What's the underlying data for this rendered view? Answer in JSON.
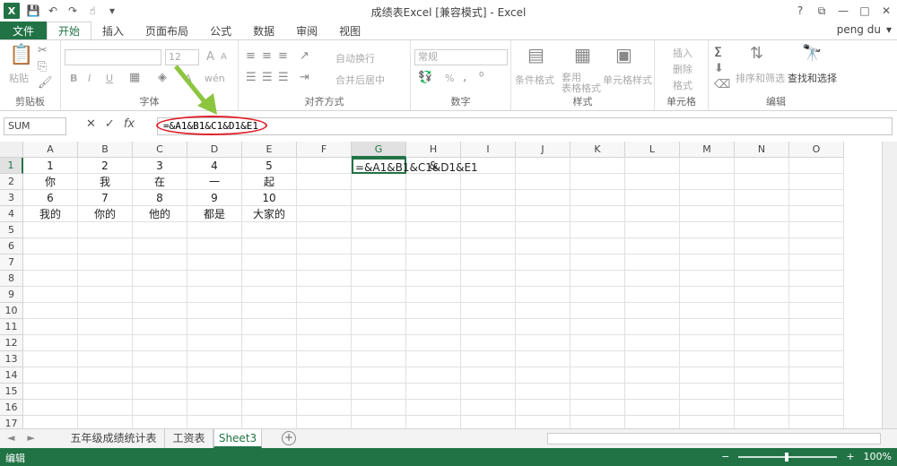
{
  "window": {
    "title": "成绩表Excel  [兼容模式] - Excel",
    "logo": "X",
    "help": "?",
    "restore": "⧉",
    "minimize": "—",
    "maximize": "□",
    "close": "✕"
  },
  "tabs": [
    "文件",
    "开始",
    "插入",
    "页面布局",
    "公式",
    "数据",
    "审阅",
    "视图"
  ],
  "user": {
    "name": "peng du"
  },
  "ribbon": {
    "clipboard": {
      "label": "剪贴板",
      "paste": "粘贴"
    },
    "font": {
      "label": "字体",
      "size": "12",
      "bold": "B",
      "italic": "I",
      "underline": "U",
      "font_color": "A",
      "grow": "A",
      "shrink": "A",
      "phonetic": "wén"
    },
    "alignment": {
      "label": "对齐方式",
      "wrap": "自动换行",
      "merge": "合并后居中"
    },
    "number": {
      "label": "数字",
      "format": "常规",
      "percent": "%"
    },
    "styles": {
      "label": "样式",
      "conditional": "条件格式",
      "table": "套用\n表格格式",
      "cell_styles": "单元格样式"
    },
    "cells": {
      "label": "单元格",
      "insert": "插入",
      "delete": "删除",
      "format": "格式"
    },
    "editing": {
      "label": "编辑",
      "sort": "排序和筛选",
      "find": "查找和选择",
      "sigma": "Σ"
    }
  },
  "formula_bar": {
    "name_box": "SUM",
    "cancel": "✕",
    "enter": "✓",
    "fx": "fx",
    "value": "=&A1&B1&C1&D1&E1"
  },
  "columns": [
    "A",
    "B",
    "C",
    "D",
    "E",
    "F",
    "G",
    "H",
    "I",
    "J",
    "K",
    "L",
    "M",
    "N",
    "O"
  ],
  "rows": [
    "1",
    "2",
    "3",
    "4",
    "5",
    "6",
    "7",
    "8",
    "9",
    "10",
    "11",
    "12",
    "13",
    "14",
    "15",
    "16",
    "17"
  ],
  "cells": {
    "A1": "1",
    "B1": "2",
    "C1": "3",
    "D1": "4",
    "E1": "5",
    "A2": "你",
    "B2": "我",
    "C2": "在",
    "D2": "一",
    "E2": "起",
    "A3": "6",
    "B3": "7",
    "C3": "8",
    "D3": "9",
    "E3": "10",
    "A4": "我的",
    "B4": "你的",
    "C4": "他的",
    "D4": "都是",
    "E4": "大家的",
    "G1": "=&A1&B1&C1&D1&E1",
    "H1": "&"
  },
  "active_cell": "G1",
  "sheets": [
    "五年级成绩统计表",
    "工资表",
    "Sheet3"
  ],
  "active_sheet": "Sheet3",
  "sheet_nav": {
    "prev": "◄",
    "next": "►",
    "add": "+"
  },
  "status": {
    "mode": "编辑",
    "zoom": "100%",
    "zoom_minus": "−",
    "zoom_plus": "+"
  },
  "colors": {
    "accent": "#217346",
    "annotation_red": "#e0202a",
    "annotation_green": "#8cc63f"
  }
}
